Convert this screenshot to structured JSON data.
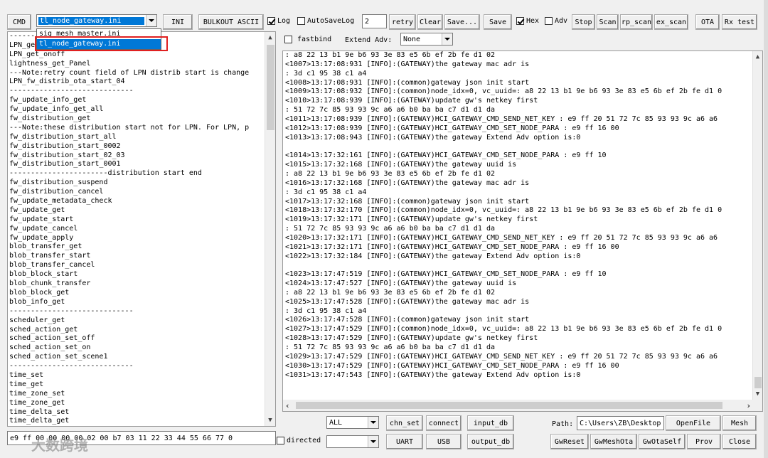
{
  "toolbar": {
    "cmd": "CMD",
    "ini_file": "tl_node_gateway.ini",
    "ini": "INI",
    "bulkout_ascii": "BULKOUT ASCII",
    "log": "Log",
    "auto_save_log": "AutoSaveLog",
    "retry_value": "2",
    "retry": "retry",
    "clear": "Clear",
    "save_dots": "Save...",
    "save": "Save",
    "hex": "Hex",
    "adv": "Adv",
    "stop": "Stop",
    "scan": "Scan",
    "rp_scan": "rp_scan",
    "ex_scan": "ex_scan",
    "ota": "OTA",
    "rx_test": "Rx test"
  },
  "dropdown": {
    "options": [
      "sig_mesh_master.ini",
      "tl_node_gateway.ini"
    ],
    "selected_index": 1
  },
  "options_row": {
    "fastbind": "fastbind",
    "extend_adv_label": "Extend Adv:",
    "extend_adv_value": "None"
  },
  "command_list": [
    "---------------------------md_debug",
    "LPN_get",
    "LPN_get_onoff",
    "lightness_get_Panel",
    "---Note:retry count field of LPN distrib start is change",
    "LPN_fw_distrib_ota_start_04",
    "-----------------------------",
    "fw_update_info_get",
    "fw_update_info_get_all",
    "fw_distribution_get",
    "---Note:these distribution start not for LPN. For LPN, p",
    "fw_distribution_start_all",
    "fw_distribution_start_0002",
    "fw_distribution_start_02_03",
    "fw_distribution_start_0001",
    "-----------------------distribution start end",
    "fw_distribution_suspend",
    "fw_distribution_cancel",
    "fw_update_metadata_check",
    "fw_update_get",
    "fw_update_start",
    "fw_update_cancel",
    "fw_update_apply",
    "blob_transfer_get",
    "blob_transfer_start",
    "blob_transfer_cancel",
    "blob_block_start",
    "blob_chunk_transfer",
    "blob_block_get",
    "blob_info_get",
    "-----------------------------",
    "scheduler_get",
    "sched_action_get",
    "sched_action_set_off",
    "sched_action_set_on",
    "sched_action_set_scene1",
    "-----------------------------",
    "time_set",
    "time_get",
    "time_zone_set",
    "time_zone_get",
    "time_delta_set",
    "time_delta_get"
  ],
  "log_lines": [
    ": a8 22 13 b1 9e b6 93 3e 83 e5 6b ef 2b fe d1 02",
    "<1007>13:17:08:931 [INFO]:(GATEWAY)the gateway mac adr is",
    ": 3d c1 95 38 c1 a4",
    "<1008>13:17:08:931 [INFO]:(common)gateway json init start",
    "<1009>13:17:08:932 [INFO]:(common)node_idx=0, vc_uuid=: a8 22 13 b1 9e b6 93 3e 83 e5 6b ef 2b fe d1 0",
    "<1010>13:17:08:939 [INFO]:(GATEWAY)update gw's netkey first",
    ": 51 72 7c 85 93 93 9c a6 a6 b0 ba ba c7 d1 d1 da",
    "<1011>13:17:08:939 [INFO]:(GATEWAY)HCI_GATEWAY_CMD_SEND_NET_KEY : e9 ff 20 51 72 7c 85 93 93 9c a6 a6",
    "<1012>13:17:08:939 [INFO]:(GATEWAY)HCI_GATEWAY_CMD_SET_NODE_PARA : e9 ff 16 00",
    "<1013>13:17:08:943 [INFO]:(GATEWAY)the gateway Extend Adv option is:0",
    "",
    "<1014>13:17:32:161 [INFO]:(GATEWAY)HCI_GATEWAY_CMD_SET_NODE_PARA : e9 ff 10",
    "<1015>13:17:32:168 [INFO]:(GATEWAY)the gateway uuid is",
    ": a8 22 13 b1 9e b6 93 3e 83 e5 6b ef 2b fe d1 02",
    "<1016>13:17:32:168 [INFO]:(GATEWAY)the gateway mac adr is",
    ": 3d c1 95 38 c1 a4",
    "<1017>13:17:32:168 [INFO]:(common)gateway json init start",
    "<1018>13:17:32:170 [INFO]:(common)node_idx=0, vc_uuid=: a8 22 13 b1 9e b6 93 3e 83 e5 6b ef 2b fe d1 0",
    "<1019>13:17:32:171 [INFO]:(GATEWAY)update gw's netkey first",
    ": 51 72 7c 85 93 93 9c a6 a6 b0 ba ba c7 d1 d1 da",
    "<1020>13:17:32:171 [INFO]:(GATEWAY)HCI_GATEWAY_CMD_SEND_NET_KEY : e9 ff 20 51 72 7c 85 93 93 9c a6 a6",
    "<1021>13:17:32:171 [INFO]:(GATEWAY)HCI_GATEWAY_CMD_SET_NODE_PARA : e9 ff 16 00",
    "<1022>13:17:32:184 [INFO]:(GATEWAY)the gateway Extend Adv option is:0",
    "",
    "<1023>13:17:47:519 [INFO]:(GATEWAY)HCI_GATEWAY_CMD_SET_NODE_PARA : e9 ff 10",
    "<1024>13:17:47:527 [INFO]:(GATEWAY)the gateway uuid is",
    ": a8 22 13 b1 9e b6 93 3e 83 e5 6b ef 2b fe d1 02",
    "<1025>13:17:47:528 [INFO]:(GATEWAY)the gateway mac adr is",
    ": 3d c1 95 38 c1 a4",
    "<1026>13:17:47:528 [INFO]:(common)gateway json init start",
    "<1027>13:17:47:529 [INFO]:(common)node_idx=0, vc_uuid=: a8 22 13 b1 9e b6 93 3e 83 e5 6b ef 2b fe d1 0",
    "<1028>13:17:47:529 [INFO]:(GATEWAY)update gw's netkey first",
    ": 51 72 7c 85 93 93 9c a6 a6 b0 ba ba c7 d1 d1 da",
    "<1029>13:17:47:529 [INFO]:(GATEWAY)HCI_GATEWAY_CMD_SEND_NET_KEY : e9 ff 20 51 72 7c 85 93 93 9c a6 a6",
    "<1030>13:17:47:529 [INFO]:(GATEWAY)HCI_GATEWAY_CMD_SET_NODE_PARA : e9 ff 16 00",
    "<1031>13:17:47:543 [INFO]:(GATEWAY)the gateway Extend Adv option is:0"
  ],
  "bottom": {
    "hex_input": "e9 ff 00 00 00 00 02 00 b7 03 11 22 33 44 55 66 77 0",
    "directed": "directed",
    "all": "ALL",
    "directed_combo": "",
    "chn_set": "chn_set",
    "connect": "connect",
    "input_db": "input_db",
    "uart": "UART",
    "usb": "USB",
    "output_db": "output_db",
    "path_label": "Path:",
    "path_value": "C:\\Users\\ZB\\Desktop",
    "open_file": "OpenFile",
    "mesh": "Mesh",
    "gw_reset": "GwReset",
    "gw_mesh_ota": "GwMeshOta",
    "gw_ota_self": "GwOtaSelf",
    "prov": "Prov",
    "close": "Close"
  },
  "watermark": "大数跨境",
  "colors": {
    "selection": "#0078d7",
    "highlight_outline": "#e02020"
  },
  "icons": {
    "dropdown": "chevron-down-icon",
    "scroll_up": "arrow-up-icon",
    "scroll_down": "arrow-down-icon",
    "scroll_left": "arrow-left-icon",
    "scroll_right": "arrow-right-icon"
  }
}
